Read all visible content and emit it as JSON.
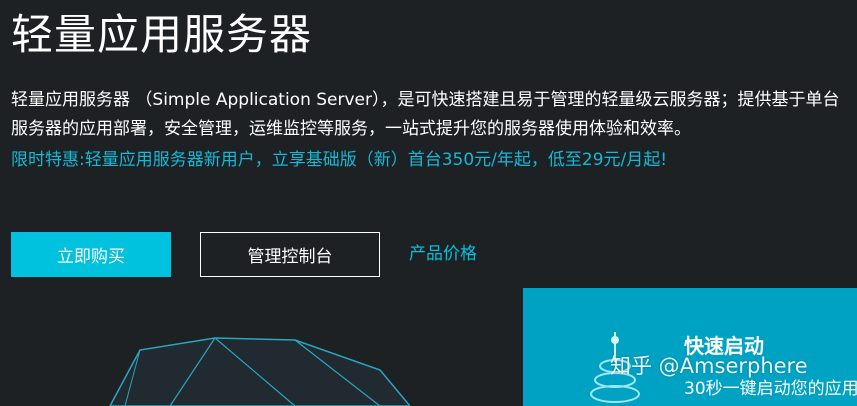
{
  "header": {
    "title": "轻量应用服务器",
    "description": "轻量应用服务器 （Simple Application Server），是可快速搭建且易于管理的轻量级云服务器；提供基于单台服务器的应用部署，安全管理，运维监控等服务，一站式提升您的服务器使用体验和效率。",
    "promo": "限时特惠:轻量应用服务器新用户，立享基础版（新）首台350元/年起，低至29元/月起!"
  },
  "actions": {
    "buy_label": "立即购买",
    "console_label": "管理控制台",
    "price_label": "产品价格"
  },
  "quickstart": {
    "title": "快速启动",
    "subtitle": "30秒一键启动您的应用"
  },
  "watermark": "知乎 @Amserphere",
  "colors": {
    "background": "#1e2124",
    "accent": "#00c1de",
    "panel": "#00a2c4",
    "promo_text": "#15b8d6"
  }
}
